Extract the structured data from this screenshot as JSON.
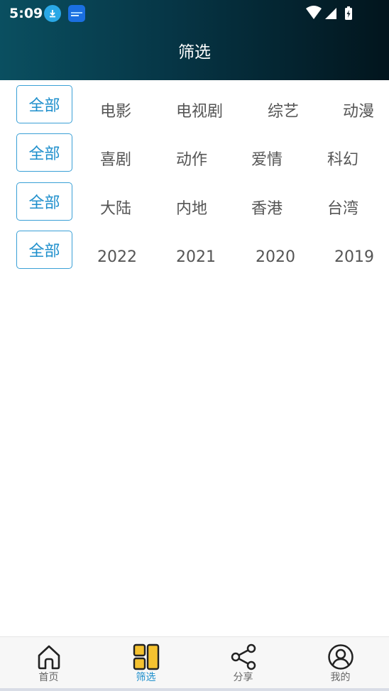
{
  "status_bar": {
    "time": "5:09"
  },
  "header": {
    "title": "筛选"
  },
  "filters": {
    "all_label": "全部",
    "rows": [
      {
        "options": [
          "电影",
          "电视剧",
          "综艺",
          "动漫"
        ]
      },
      {
        "options": [
          "喜剧",
          "动作",
          "爱情",
          "科幻"
        ]
      },
      {
        "options": [
          "大陆",
          "内地",
          "香港",
          "台湾"
        ]
      },
      {
        "options": [
          "2022",
          "2021",
          "2020",
          "2019"
        ]
      }
    ]
  },
  "tabbar": {
    "tabs": [
      {
        "label": "首页",
        "icon": "home-icon"
      },
      {
        "label": "筛选",
        "icon": "filter-grid-icon",
        "active": true
      },
      {
        "label": "分享",
        "icon": "share-icon"
      },
      {
        "label": "我的",
        "icon": "profile-icon"
      }
    ]
  },
  "colors": {
    "accent": "#1e8fcc",
    "header_start": "#0a4f60",
    "header_end": "#02151d",
    "active_icon": "#f5c230"
  }
}
